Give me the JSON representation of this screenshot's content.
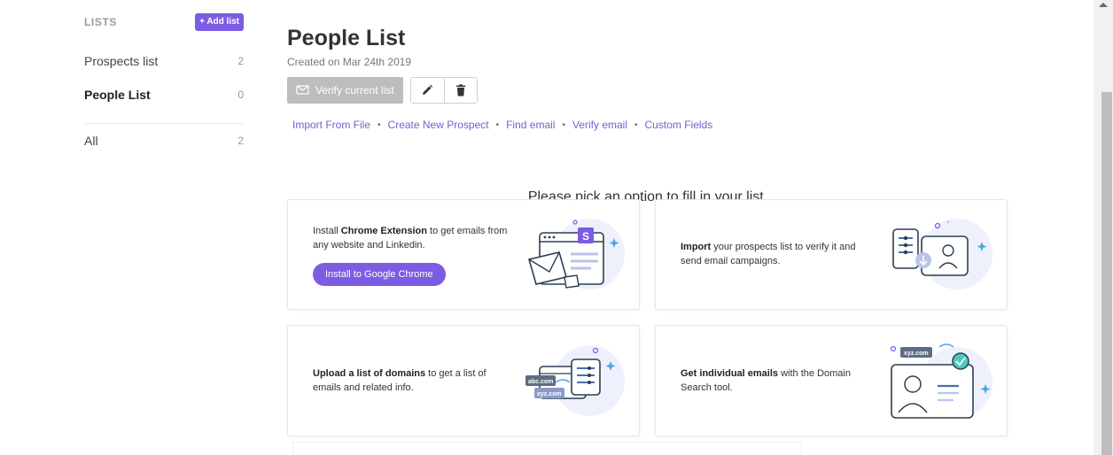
{
  "sidebar": {
    "title": "LISTS",
    "add_list_label": "+ Add list",
    "items": [
      {
        "name": "Prospects list",
        "count": "2"
      },
      {
        "name": "People List",
        "count": "0"
      },
      {
        "name": "All",
        "count": "2"
      }
    ]
  },
  "main": {
    "title": "People List",
    "created": "Created on Mar 24th 2019",
    "verify_label": "Verify current list",
    "links": [
      "Import From File",
      "Create New Prospect",
      "Find email",
      "Verify email",
      "Custom Fields"
    ],
    "prompt": "Please pick an option to fill in your list."
  },
  "cards": {
    "chrome": {
      "bold": "Chrome Extension",
      "pre": "Install ",
      "post": " to get emails from any website and Linkedin.",
      "button": "Install to Google Chrome"
    },
    "import": {
      "bold": "Import",
      "post": " your prospects list to verify it and send email campaigns."
    },
    "domains": {
      "bold": "Upload a list of domains",
      "post": " to get a list of emails and related info.",
      "tag1": "abc.com",
      "tag2": "xyz.com"
    },
    "individual": {
      "bold": "Get individual emails",
      "post": " with the Domain Search tool.",
      "tag": "xyz.com"
    }
  },
  "colors": {
    "accent": "#7c5ce2",
    "link": "#6c63d6"
  }
}
